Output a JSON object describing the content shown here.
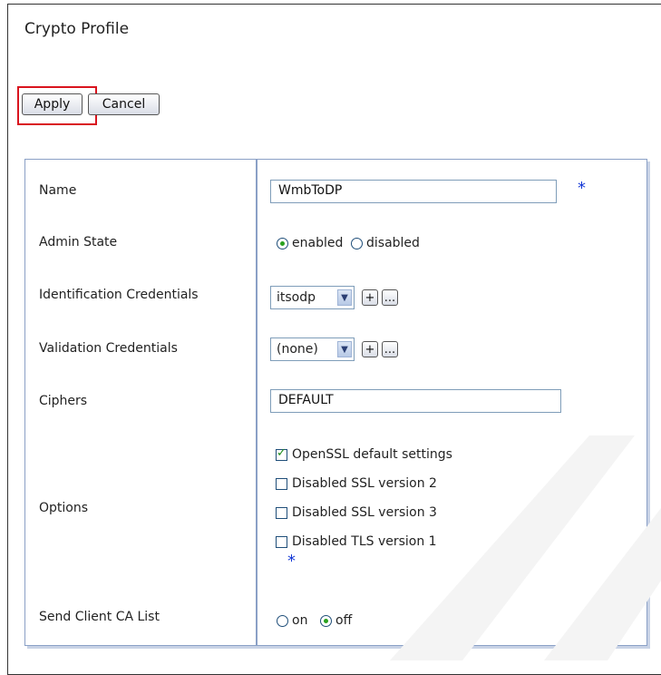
{
  "page": {
    "title": "Crypto Profile"
  },
  "buttons": {
    "apply": "Apply",
    "cancel": "Cancel"
  },
  "form": {
    "name": {
      "label": "Name",
      "value": "WmbToDP",
      "required_mark": "*"
    },
    "admin_state": {
      "label": "Admin State",
      "options": [
        "enabled",
        "disabled"
      ],
      "selected": "enabled"
    },
    "identification_credentials": {
      "label": "Identification Credentials",
      "value": "itsodp",
      "add": "+",
      "more": "..."
    },
    "validation_credentials": {
      "label": "Validation Credentials",
      "value": "(none)",
      "add": "+",
      "more": "..."
    },
    "ciphers": {
      "label": "Ciphers",
      "value": "DEFAULT"
    },
    "options": {
      "label": "Options",
      "items": [
        {
          "label": "OpenSSL default settings",
          "checked": true
        },
        {
          "label": "Disabled SSL version 2",
          "checked": false
        },
        {
          "label": "Disabled SSL version 3",
          "checked": false
        },
        {
          "label": "Disabled TLS version 1",
          "checked": false
        }
      ],
      "required_mark": "*"
    },
    "send_client_ca_list": {
      "label": "Send Client CA List",
      "options": [
        "on",
        "off"
      ],
      "selected": "off"
    }
  },
  "colors": {
    "highlight": "#d9141e",
    "panel_border": "#8aa0c6",
    "required": "#1438d6",
    "radio_fill": "#2aa11f"
  },
  "icons": {
    "dropdown": "chevron-down-icon",
    "check": "check-icon"
  }
}
